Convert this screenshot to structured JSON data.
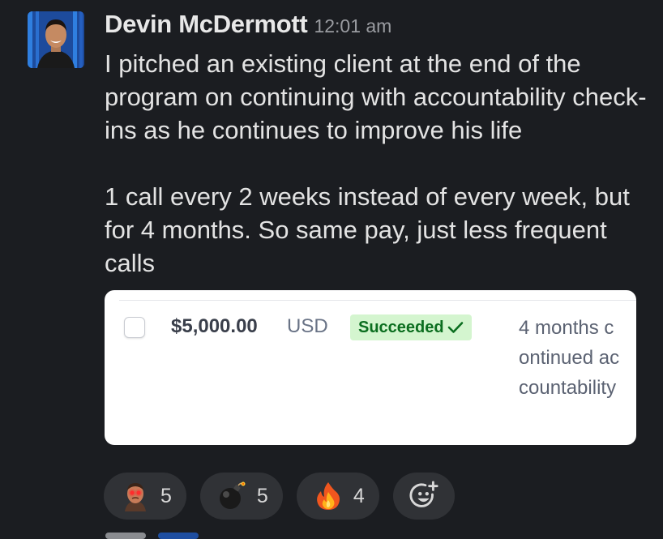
{
  "message": {
    "author": "Devin McDermott",
    "time": "12:01 am",
    "paragraphs": [
      "I pitched an existing client at the end of the program on continuing with accountability check-ins as he continues to improve his life",
      "1 call every 2 weeks instead of every week, but for 4 months. So same pay, just less frequent calls"
    ]
  },
  "attachment": {
    "amount": "$5,000.00",
    "currency": "USD",
    "status": "Succeeded",
    "description": "4 months continued accountability",
    "colors": {
      "status_bg": "#d4f5cf",
      "status_text": "#0b6e1f"
    }
  },
  "reactions": [
    {
      "icon": "angry-man-emoji-icon",
      "count": "5"
    },
    {
      "icon": "bomb-emoji-icon",
      "count": "5"
    },
    {
      "icon": "fire-emoji-icon",
      "count": "4"
    }
  ],
  "add_reaction_icon": "add-reaction-icon"
}
